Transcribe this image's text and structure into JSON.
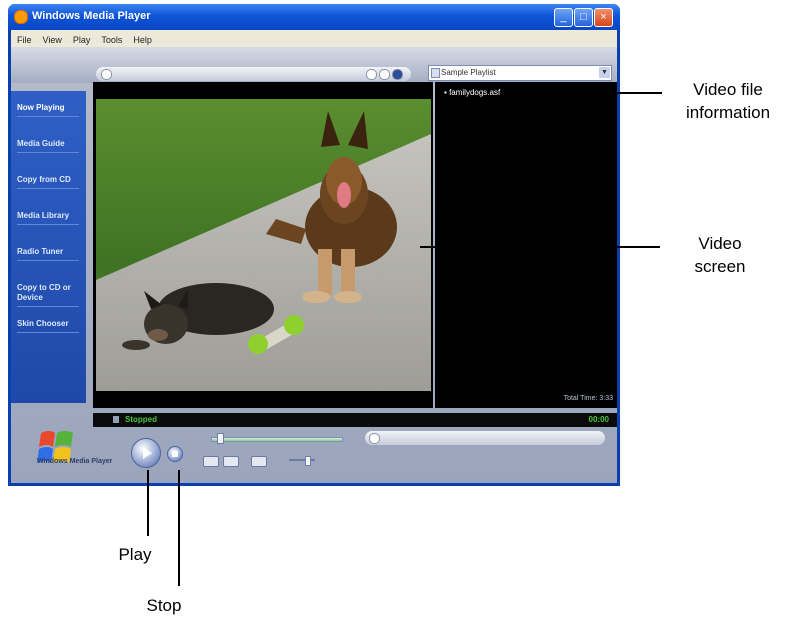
{
  "window": {
    "title": "Windows Media Player",
    "menu": [
      "File",
      "View",
      "Play",
      "Tools",
      "Help"
    ]
  },
  "taskbar": {
    "items": [
      "Now Playing",
      "Media Guide",
      "Copy from CD",
      "Media Library",
      "Radio Tuner",
      "Copy to CD or Device",
      "Skin Chooser"
    ]
  },
  "playlist": {
    "selected": "Sample Playlist",
    "file": "familydogs.asf",
    "total_time": "Total Time: 3:33"
  },
  "status": {
    "text": "Stopped",
    "time": "00:00"
  },
  "logo": {
    "text": "Windows Media Player"
  },
  "callouts": {
    "video_info_line1": "Video file",
    "video_info_line2": "information",
    "video_screen_line1": "Video",
    "video_screen_line2": "screen",
    "play": "Play",
    "stop": "Stop"
  },
  "colors": {
    "titlebar": "#0f55d8",
    "taskbar": "#2f5fc6",
    "status_green": "#49c43d"
  }
}
